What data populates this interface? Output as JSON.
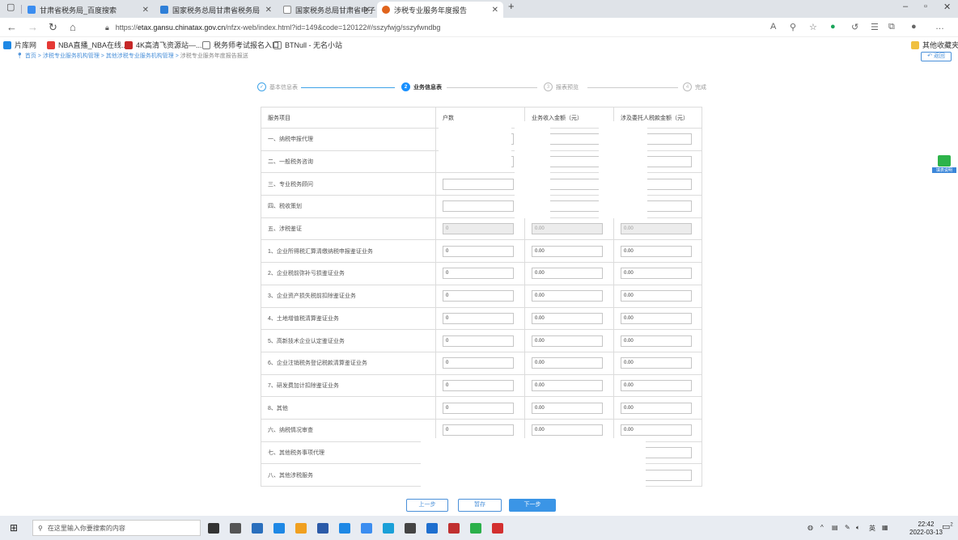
{
  "tabs": [
    {
      "title": "甘肃省税务局_百度搜索",
      "icon_color": "#3b8df0"
    },
    {
      "title": "国家税务总局甘肃省税务局",
      "icon_color": "#2e7fd8"
    },
    {
      "title": "国家税务总局甘肃省电子税务局",
      "icon_color": "#888888"
    },
    {
      "title": "涉税专业服务年度报告",
      "icon_color": "#e0641c"
    }
  ],
  "address": {
    "prefix": "https://",
    "domain": "etax.gansu.chinatax.gov.cn",
    "path": "/nfzx-web/index.html?id=149&code=120122#/sszyfwjg/sszyfwndbg"
  },
  "bookmarks": [
    {
      "label": "片库网",
      "icon_color": "#1e88e5"
    },
    {
      "label": "NBA直播_NBA在线...",
      "icon_color": "#e53935"
    },
    {
      "label": "4K高清飞资源站—...",
      "icon_color": "#c62828"
    },
    {
      "label": "税务师考试报名入口",
      "icon_color": "#777777"
    },
    {
      "label": "BTNull - 无名小站",
      "icon_color": "#777777"
    }
  ],
  "other_bookmarks": "其他收藏夹",
  "breadcrumb": {
    "home": "首页",
    "items": [
      "涉税专业服务机构管理",
      "其他涉税专业服务机构管理"
    ],
    "current": "涉税专业服务年度报告报送"
  },
  "return_label": "返回",
  "steps": [
    {
      "num": "✓",
      "label": "基本信息表"
    },
    {
      "num": "2",
      "label": "业务信息表"
    },
    {
      "num": "3",
      "label": "报表预览"
    },
    {
      "num": "4",
      "label": "完成"
    }
  ],
  "table": {
    "headers": [
      "服务项目",
      "户数",
      "业务收入金额（元）",
      "涉及委托人税款金额（元）"
    ],
    "rows": [
      {
        "label": "一、纳税申报代理",
        "values": [
          "",
          "",
          ""
        ]
      },
      {
        "label": "二、一般税务咨询",
        "values": [
          "",
          "",
          ""
        ]
      },
      {
        "label": "三、专业税务顾问",
        "values": [
          "",
          "",
          ""
        ]
      },
      {
        "label": "四、税收策划",
        "values": [
          "",
          "",
          ""
        ]
      },
      {
        "label": "五、涉税鉴证",
        "values": [
          "0",
          "0.00",
          "0.00"
        ],
        "disabled": true
      },
      {
        "label": "1、企业所得税汇算清缴纳税申报鉴证业务",
        "values": [
          "0",
          "0.00",
          "0.00"
        ]
      },
      {
        "label": "2、企业税前弥补亏损鉴证业务",
        "values": [
          "0",
          "0.00",
          "0.00"
        ]
      },
      {
        "label": "3、企业资产损失税前扣除鉴证业务",
        "values": [
          "0",
          "0.00",
          "0.00"
        ]
      },
      {
        "label": "4、土地增值税清算鉴证业务",
        "values": [
          "0",
          "0.00",
          "0.00"
        ]
      },
      {
        "label": "5、高新技术企业认定鉴证业务",
        "values": [
          "0",
          "0.00",
          "0.00"
        ]
      },
      {
        "label": "6、企业注销税务登记税款清算鉴证业务",
        "values": [
          "0",
          "0.00",
          "0.00"
        ]
      },
      {
        "label": "7、研发费加计扣除鉴证业务",
        "values": [
          "0",
          "0.00",
          "0.00"
        ]
      },
      {
        "label": "8、其他",
        "values": [
          "0",
          "0.00",
          "0.00"
        ]
      },
      {
        "label": "六、纳税情况审查",
        "values": [
          "0",
          "0.00",
          "0.00"
        ]
      },
      {
        "label": "七、其他税务事项代理",
        "values": [
          "",
          "",
          ""
        ]
      },
      {
        "label": "八、其他涉税服务",
        "values": [
          "",
          "",
          ""
        ]
      }
    ]
  },
  "buttons": {
    "prev": "上一步",
    "save": "暂存",
    "next": "下一步"
  },
  "side_widget": "填表说明",
  "taskbar": {
    "search_placeholder": "在这里输入你要搜索的内容",
    "time": "22:42",
    "date": "2022-03-13",
    "lang": "英",
    "notifications": "2",
    "app_icon_colors": [
      "#333333",
      "#555555",
      "#2a6fbd",
      "#1e88e5",
      "#f0a020",
      "#2b5aa8",
      "#1e88e5",
      "#3b8df0",
      "#1aa0d8",
      "#444444",
      "#1e6fcf",
      "#c03030",
      "#2bb04a",
      "#d33030"
    ]
  }
}
